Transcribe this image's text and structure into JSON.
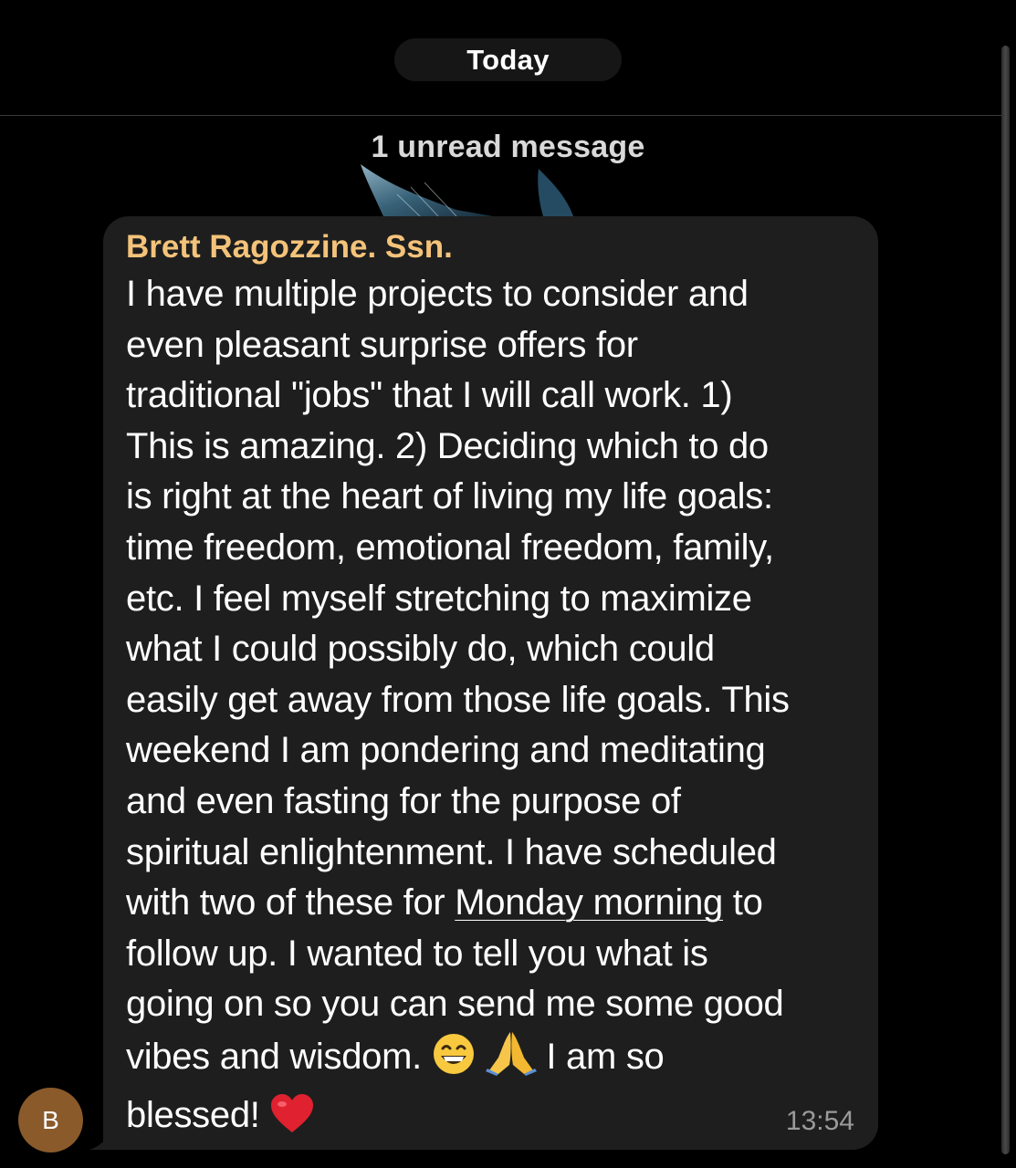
{
  "date_separator": "Today",
  "unread_banner": "1 unread message",
  "avatar_initial": "B",
  "message": {
    "sender": "Brett Ragozzine. Ssn.",
    "text_part1": "I have multiple projects to consider and\neven pleasant surprise offers for\ntraditional \"jobs\" that I will call work. 1)\nThis is amazing. 2) Deciding which to do\nis right at the heart of living my life goals:\ntime freedom, emotional freedom, family,\netc. I feel myself stretching to maximize\nwhat I could possibly do, which could\neasily get away from those life goals. This\nweekend I am pondering and meditating\nand even fasting for the purpose of\nspiritual enlightenment. I have scheduled\nwith two of these for ",
    "link_text": "Monday morning",
    "text_part2": " to\nfollow up. I wanted to tell you what is\ngoing on so you can send me some good\nvibes and wisdom. ",
    "text_part3": " I am so\nblessed! ",
    "time": "13:54"
  },
  "icons": {
    "emoji_1": "grinning-face-with-smiling-eyes-icon",
    "emoji_2": "folded-hands-icon",
    "emoji_3": "red-heart-icon"
  },
  "colors": {
    "background": "#000000",
    "bubble": "#1e1e1e",
    "sender_name": "#f4c37a",
    "message_text": "#ffffff",
    "timestamp": "#9a9a9a",
    "date_pill": "#161616",
    "avatar": "#8a5a2b"
  }
}
